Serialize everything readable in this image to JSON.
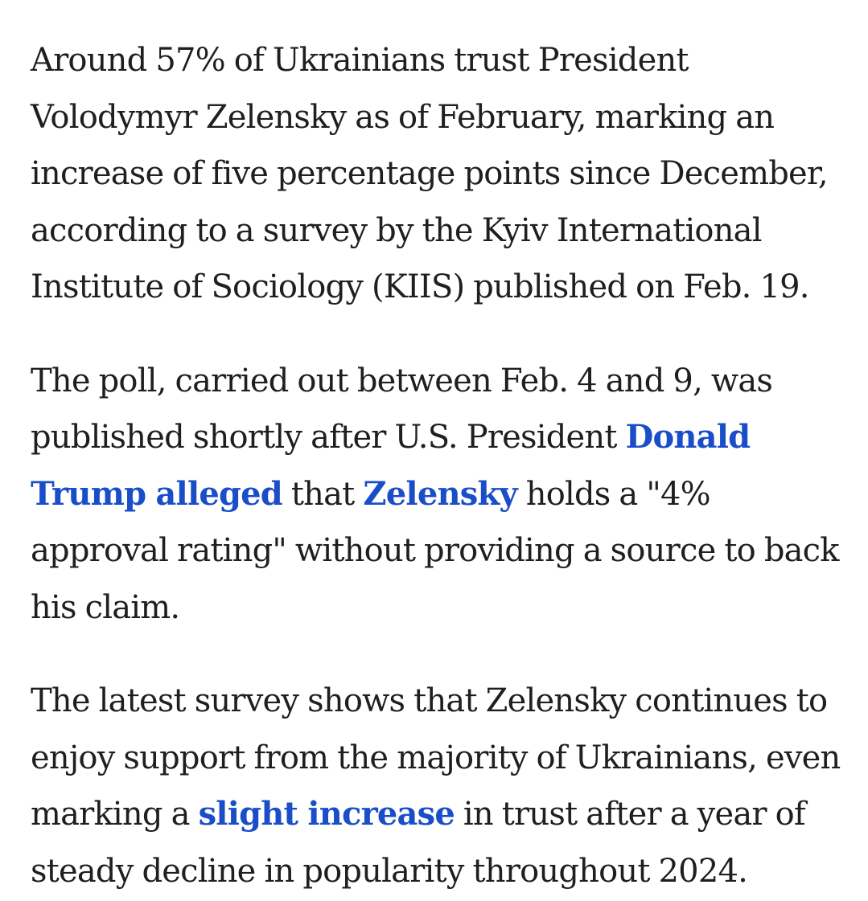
{
  "article": {
    "paragraph_1": {
      "text": "Around 57% of Ukrainians trust President Volodymyr Zelensky as of February, marking an increase of five percentage points since December, according to a survey by the Kyiv International Institute of Sociology (KIIS) published on Feb. 19."
    },
    "paragraph_2": {
      "text_before_link_1": "The poll, carried out between Feb. 4 and 9, was published shortly after U.S. President ",
      "link_1": "Donald Trump alleged",
      "text_between_links": " that ",
      "link_2": "Zelensky",
      "text_after_link_2": " holds a \"4% approval rating\" without providing a source to back his claim."
    },
    "paragraph_3": {
      "text_before_link": "The latest survey shows that Zelensky continues to enjoy support from the majority of Ukrainians, even marking a ",
      "link": "slight increase",
      "text_after_link": " in trust after a year of steady decline in popularity throughout 2024."
    }
  },
  "colors": {
    "text": "#1f1f1f",
    "link": "#1a4ec9",
    "background": "#ffffff"
  }
}
